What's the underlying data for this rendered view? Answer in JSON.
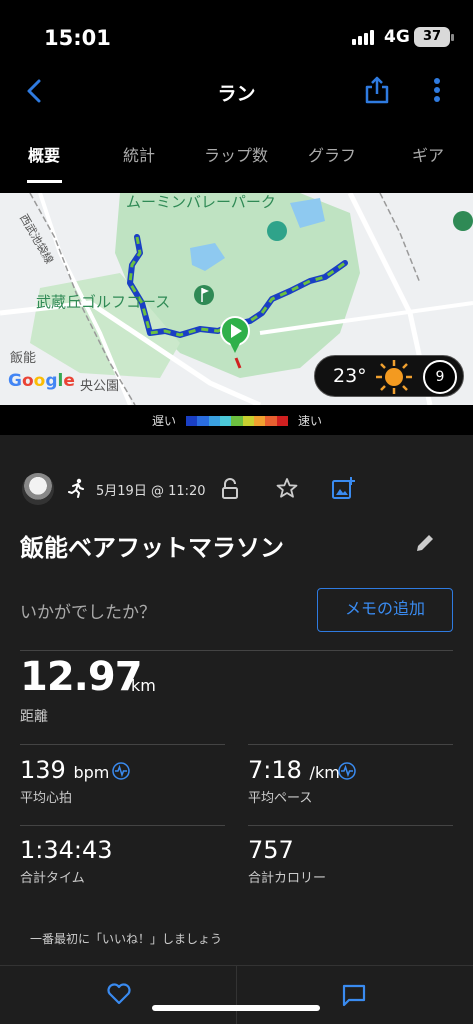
{
  "status": {
    "time": "15:01",
    "network": "4G",
    "battery": "37"
  },
  "header": {
    "title": "ラン",
    "back_icon": "chevron-left-icon",
    "share_icon": "share-icon",
    "more_icon": "more-vertical-icon"
  },
  "tabs": [
    {
      "label": "概要",
      "active": true
    },
    {
      "label": "統計",
      "active": false
    },
    {
      "label": "ラップ数",
      "active": false
    },
    {
      "label": "グラフ",
      "active": false
    },
    {
      "label": "ギア",
      "active": false
    }
  ],
  "map": {
    "labels": {
      "park": "ムーミンバレーパーク",
      "golf": "武蔵丘ゴルフコース",
      "hanno": "飯能",
      "line": "西武池袋線",
      "central_park": "央公園"
    },
    "google": "Google",
    "weather": {
      "temp": "23°",
      "wind": "9"
    }
  },
  "legend": {
    "slow": "遅い",
    "fast": "速い",
    "colors": [
      "#1a3fc4",
      "#2a6de0",
      "#3aa0e0",
      "#4bc8d8",
      "#6cc040",
      "#c8d030",
      "#f0a030",
      "#e86030",
      "#d02020"
    ]
  },
  "activity": {
    "date": "5月19日 @ 11:20",
    "title": "飯能ベアフットマラソン",
    "prompt": "いかがでしたか？",
    "memo_button": "メモの追加"
  },
  "stats": {
    "distance": {
      "value": "12.97",
      "unit": "km",
      "label": "距離"
    },
    "avg_hr": {
      "value": "139",
      "unit": "bpm",
      "label": "平均心拍"
    },
    "avg_pace": {
      "value": "7:18",
      "unit": "/km",
      "label": "平均ペース"
    },
    "total_time": {
      "value": "1:34:43",
      "label": "合計タイム"
    },
    "calories": {
      "value": "757",
      "label": "合計カロリー"
    }
  },
  "social": {
    "first_like": "一番最初に「いいね！」しましょう"
  },
  "accent_color": "#2f7be0"
}
